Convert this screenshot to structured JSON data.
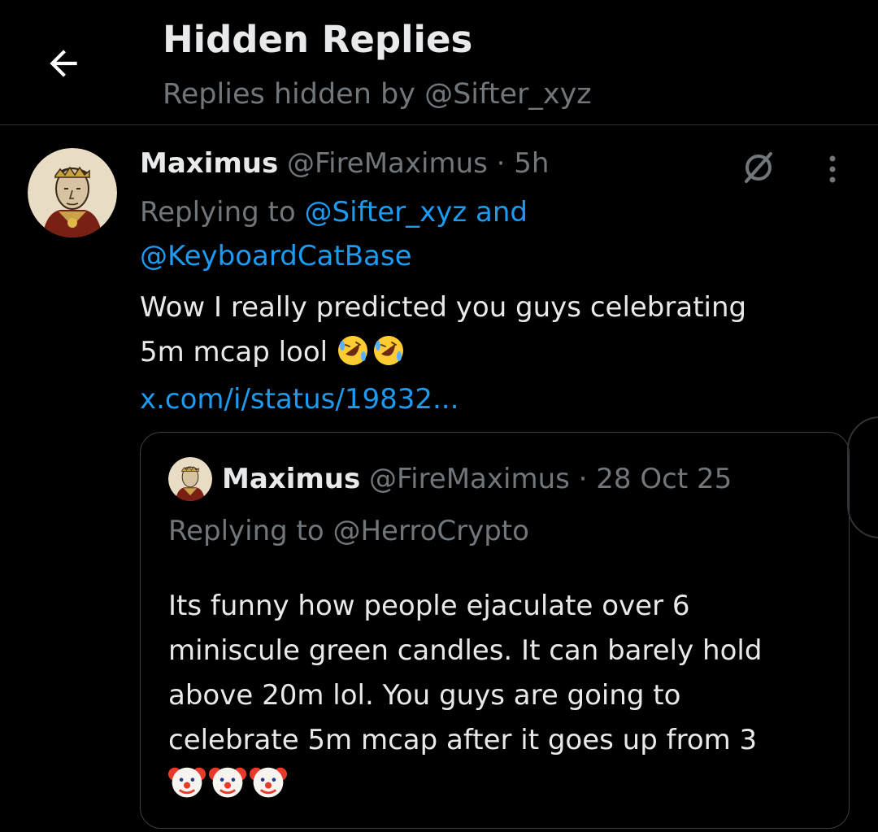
{
  "header": {
    "title": "Hidden Replies",
    "subtitle": "Replies hidden by @Sifter_xyz",
    "back_icon": "arrow-left-icon"
  },
  "tweet": {
    "author_name": "Maximus",
    "author_handle": "@FireMaximus",
    "separator": "·",
    "time": "5h",
    "replying_prefix": "Replying to",
    "replying_to_1": "@Sifter_xyz and",
    "replying_to_2": "@KeyboardCatBase",
    "text_line_1": "Wow I really predicted you guys celebrating",
    "text_line_2": "5m mcap lool",
    "link": "x.com/i/status/19832...",
    "emojis": [
      "rolling-on-floor-laughing",
      "rolling-on-floor-laughing"
    ],
    "hide_icon": "hidden-reply-icon",
    "more_icon": "more-vertical-icon"
  },
  "quote": {
    "author_name": "Maximus",
    "author_handle": "@FireMaximus",
    "separator": "·",
    "date": "28 Oct 25",
    "replying_line": "Replying to @HerroCrypto",
    "text_lines": [
      "Its funny how people ejaculate over 6",
      "miniscule green candles. It can barely hold",
      "above 20m lol. You guys are going to",
      "celebrate 5m mcap after it goes up from 3"
    ],
    "emojis": [
      "clown-face",
      "clown-face",
      "clown-face"
    ]
  },
  "colors": {
    "background": "#000000",
    "text": "#e7e9ea",
    "muted": "#71767b",
    "link": "#1d9bf0",
    "border": "#2f3336"
  }
}
